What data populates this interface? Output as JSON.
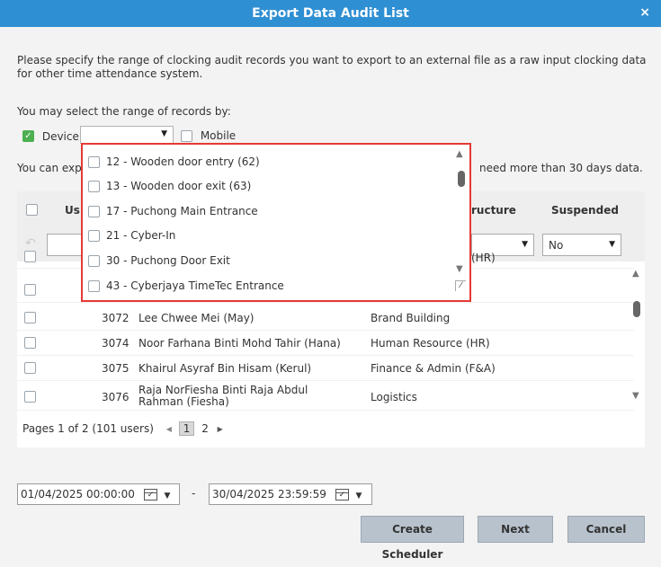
{
  "dialog": {
    "title": "Export Data Audit List",
    "close": "×"
  },
  "description": "Please specify the range of clocking audit records you want to export to an external file as a raw input clocking data for other time attendance system.",
  "range_label": "You may select the range of records by:",
  "device": {
    "label": "Device",
    "checked": true,
    "selected": ""
  },
  "mobile": {
    "label": "Mobile",
    "checked": false
  },
  "export_note": {
    "left": "You can exp",
    "right": "need more than 30 days data."
  },
  "table": {
    "headers": {
      "user": "Us",
      "structure": "ructure",
      "suspended": "Suspended"
    },
    "suspended_filter": "No",
    "partial_row_text": "(HR)",
    "rows": [
      {
        "id": "3072",
        "name": "Lee Chwee Mei (May)",
        "org": "Brand Building"
      },
      {
        "id": "3074",
        "name": "Noor Farhana Binti Mohd Tahir (Hana)",
        "org": "Human Resource (HR)"
      },
      {
        "id": "3075",
        "name": "Khairul Asyraf Bin Hisam (Kerul)",
        "org": "Finance & Admin (F&A)"
      },
      {
        "id": "3076",
        "name": "Raja NorFiesha Binti Raja Abdul",
        "name2": "Rahman (Fiesha)",
        "org": "Logistics"
      }
    ]
  },
  "pager": {
    "label": "Pages 1 of 2 (101 users)",
    "current": "1",
    "next": "2"
  },
  "dates": {
    "from": "01/04/2025 00:00:00",
    "separator": "-",
    "to": "30/04/2025 23:59:59"
  },
  "buttons": {
    "scheduler": "Create Scheduler",
    "next": "Next",
    "cancel": "Cancel"
  },
  "device_dropdown": {
    "items": [
      "12 - Wooden door entry (62)",
      "13 - Wooden door exit (63)",
      "17 - Puchong Main Entrance",
      "21 - Cyber-In",
      "30 - Puchong Door Exit",
      "43 - Cyberjaya TimeTec Entrance"
    ]
  }
}
